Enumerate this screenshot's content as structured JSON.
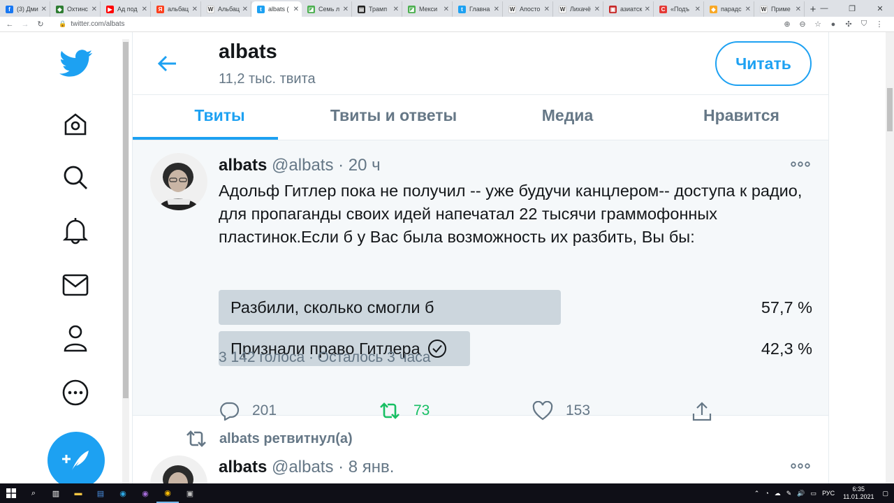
{
  "browser": {
    "tabs": [
      {
        "title": "(3) Дми",
        "color": "#1877f2",
        "glyph": "f",
        "active": false
      },
      {
        "title": "Охтинс",
        "color": "#2e7d32",
        "glyph": "◆",
        "active": false
      },
      {
        "title": "Ад под",
        "color": "#ff0000",
        "glyph": "▶",
        "active": false
      },
      {
        "title": "альбац",
        "color": "#fc3f1d",
        "glyph": "Я",
        "active": false
      },
      {
        "title": "Альбац",
        "color": "#ffffff",
        "glyph": "W",
        "active": false
      },
      {
        "title": "albats (",
        "color": "#1da1f2",
        "glyph": "t",
        "active": true
      },
      {
        "title": "Семь л",
        "color": "#4caf50",
        "glyph": "◪",
        "active": false
      },
      {
        "title": "Трамп",
        "color": "#222222",
        "glyph": "▤",
        "active": false
      },
      {
        "title": "Мекси",
        "color": "#4caf50",
        "glyph": "◪",
        "active": false
      },
      {
        "title": "Главна",
        "color": "#1da1f2",
        "glyph": "t",
        "active": false
      },
      {
        "title": "Апосто",
        "color": "#ffffff",
        "glyph": "W",
        "active": false
      },
      {
        "title": "Лихачё",
        "color": "#ffffff",
        "glyph": "W",
        "active": false
      },
      {
        "title": "азиатск",
        "color": "#c62828",
        "glyph": "▣",
        "active": false
      },
      {
        "title": "«Подъ",
        "color": "#e53935",
        "glyph": "C",
        "active": false
      },
      {
        "title": "парадс",
        "color": "#f9a825",
        "glyph": "◆",
        "active": false
      },
      {
        "title": "Приме",
        "color": "#ffffff",
        "glyph": "W",
        "active": false
      }
    ],
    "new_tab": "+",
    "url": "twitter.com/albats"
  },
  "profile": {
    "name": "albats",
    "tweet_count": "11,2 тыс. твита",
    "follow_label": "Читать"
  },
  "tabs": [
    {
      "label": "Твиты",
      "active": true
    },
    {
      "label": "Твиты и ответы",
      "active": false
    },
    {
      "label": "Медиа",
      "active": false
    },
    {
      "label": "Нравится",
      "active": false
    }
  ],
  "tweet": {
    "name": "albats",
    "handle": "@albats",
    "time": "· 20 ч",
    "text": "Адольф Гитлер пока не получил -- уже будучи канцлером-- доступа к радио, для пропаганды своих идей напечатал 22 тысячи граммофонных пластинок.Если б у Вас была возможность их разбить, Вы бы:",
    "poll": [
      {
        "label": "Разбили, сколько смогли б",
        "percent": "57,7 %",
        "share": 0.577,
        "voted": false
      },
      {
        "label": "Признали право Гитлера",
        "percent": "42,3 %",
        "share": 0.423,
        "voted": true
      }
    ],
    "poll_meta": "3 142 голоса · Осталось 3 часа",
    "replies": "201",
    "retweets": "73",
    "likes": "153"
  },
  "next": {
    "retweet_label": "albats ретвитнул(а)",
    "name": "albats",
    "handle": "@albats",
    "time": "· 8 янв."
  },
  "taskbar": {
    "lang": "РУС",
    "time": "6:35",
    "date": "11.01.2021"
  },
  "colors": {
    "accent": "#1da1f2",
    "retweet": "#17bf63",
    "text": "#14171a",
    "muted": "#657786"
  }
}
